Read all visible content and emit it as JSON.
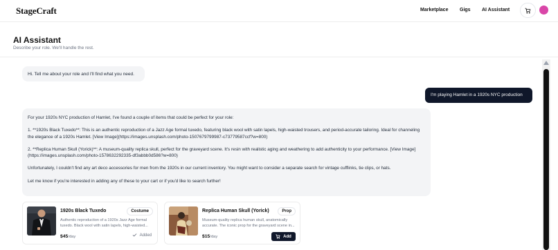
{
  "header": {
    "brand": "StageCraft",
    "nav": [
      "Marketplace",
      "Gigs",
      "AI Assistant"
    ],
    "cart_icon": "cart-icon",
    "avatar_color": "#d946a8"
  },
  "page": {
    "title": "AI Assistant",
    "subtitle": "Describe your role. We'll handle the rest."
  },
  "chat": {
    "messages": [
      {
        "role": "assistant",
        "text": "Hi. Tell me about your role and I'll find what you need."
      },
      {
        "role": "user",
        "text": "I'm playing Hamlet in a 1920s NYC production"
      },
      {
        "role": "assistant",
        "paragraphs": [
          "For your 1920s NYC production of Hamlet, I've found a couple of items that could be perfect for your role:",
          "1. **1920s Black Tuxedo**: This is an authentic reproduction of a Jazz Age formal tuxedo, featuring black wool with satin lapels, high-waisted trousers, and period-accurate tailoring. Ideal for channeling the elegance of a 1920s Hamlet. [View Image](https://images.unsplash.com/photo-1507679799987-c73779587ccf?w=800)",
          "2. **Replica Human Skull (Yorick)**: A museum-quality replica skull, perfect for the graveyard scene. It's resin with realistic aging and weathering to add authenticity to your performance. [View Image](https://images.unsplash.com/photo-1578632292335-df3abbb0d586?w=800)",
          "Unfortunately, I couldn't find any art deco accessories for men from the 1920s in our current inventory. You might want to consider a separate search for vintage cufflinks, tie clips, or hats.",
          "Let me know if you're interested in adding any of these to your cart or if you'd like to search further!"
        ]
      }
    ]
  },
  "products": [
    {
      "title": "1920s Black Tuxedo",
      "badge": "Costume",
      "description": "Authentic reproduction of a 1920s Jazz Age formal tuxedo. Black wool with satin lapels, high-waisted...",
      "price": "$45",
      "per": "/day",
      "action": "Added",
      "action_icon": "check-icon"
    },
    {
      "title": "Replica Human Skull (Yorick)",
      "badge": "Prop",
      "description": "Museum-quality replica human skull, anatomically accurate. The iconic prop for the graveyard scene in...",
      "price": "$15",
      "per": "/day",
      "action": "Add",
      "action_icon": "cart-icon"
    }
  ]
}
